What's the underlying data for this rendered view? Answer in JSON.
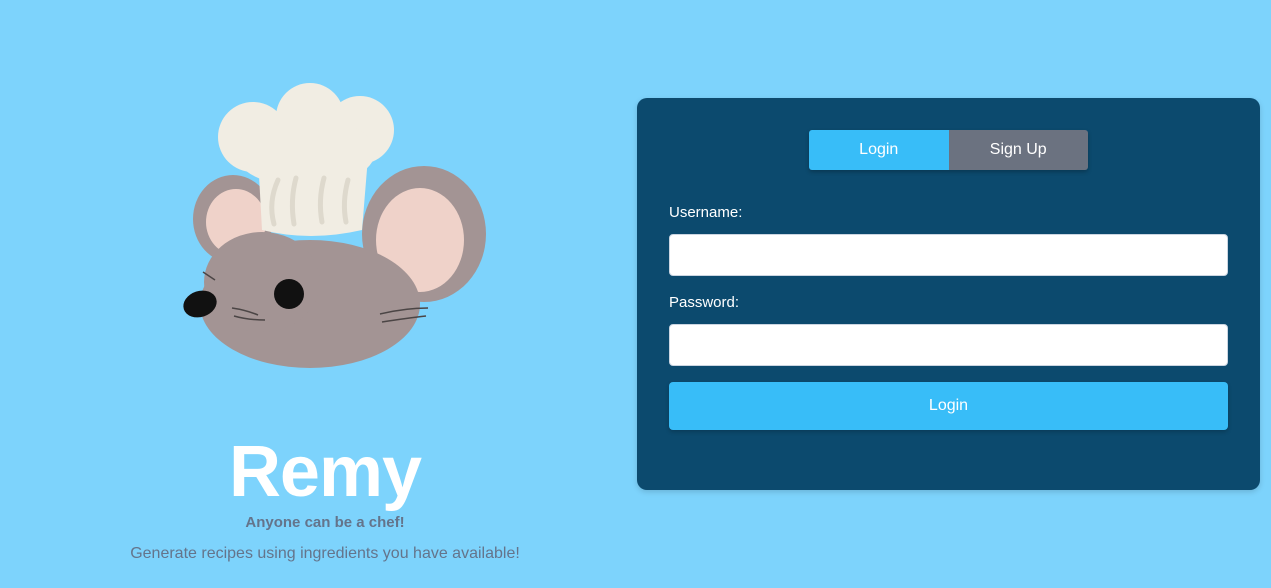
{
  "brand": {
    "title": "Remy",
    "tagline": "Anyone can be a chef!",
    "description": "Generate recipes using ingredients you have available!",
    "mascot_icon": "chef-mouse-icon"
  },
  "auth": {
    "tabs": [
      {
        "label": "Login",
        "active": true
      },
      {
        "label": "Sign Up",
        "active": false
      }
    ],
    "username_label": "Username:",
    "username_value": "",
    "password_label": "Password:",
    "password_value": "",
    "submit_label": "Login"
  },
  "colors": {
    "background": "#7dd3fc",
    "card": "#0c4a6e",
    "accent": "#38bdf8",
    "inactive_tab": "#6b7280",
    "muted_text": "#64748b"
  }
}
